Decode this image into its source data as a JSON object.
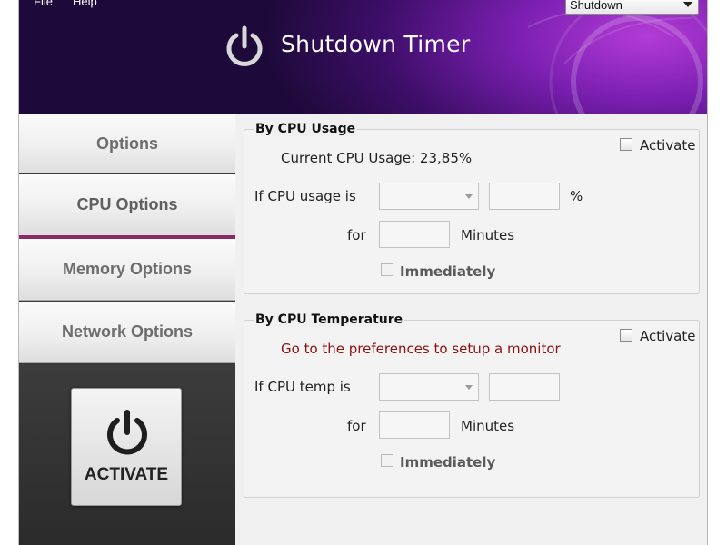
{
  "menu": {
    "file": "File",
    "help": "Help"
  },
  "app": {
    "title": "Shutdown Timer"
  },
  "mode_select": {
    "value": "Shutdown"
  },
  "sidebar": {
    "items": [
      {
        "label": "Options"
      },
      {
        "label": "CPU Options"
      },
      {
        "label": "Memory Options"
      },
      {
        "label": "Network Options"
      }
    ],
    "activate_label": "ACTIVATE"
  },
  "cpu_usage": {
    "title": "By CPU Usage",
    "activate_label": "Activate",
    "current_text": "Current CPU Usage: 23,85%",
    "if_label": "If CPU usage is",
    "unit": "%",
    "for_label": "for",
    "minutes_label": "Minutes",
    "immediately_label": "Immediately"
  },
  "cpu_temp": {
    "title": "By CPU Temperature",
    "activate_label": "Activate",
    "notice": "Go to the preferences to setup a monitor",
    "if_label": "If CPU temp is",
    "for_label": "for",
    "minutes_label": "Minutes",
    "immediately_label": "Immediately"
  },
  "colors": {
    "accent": "#8a2a66",
    "header_dark": "#1e0a3a",
    "header_purple": "#7a1fb0",
    "notice_red": "#8e1010"
  }
}
